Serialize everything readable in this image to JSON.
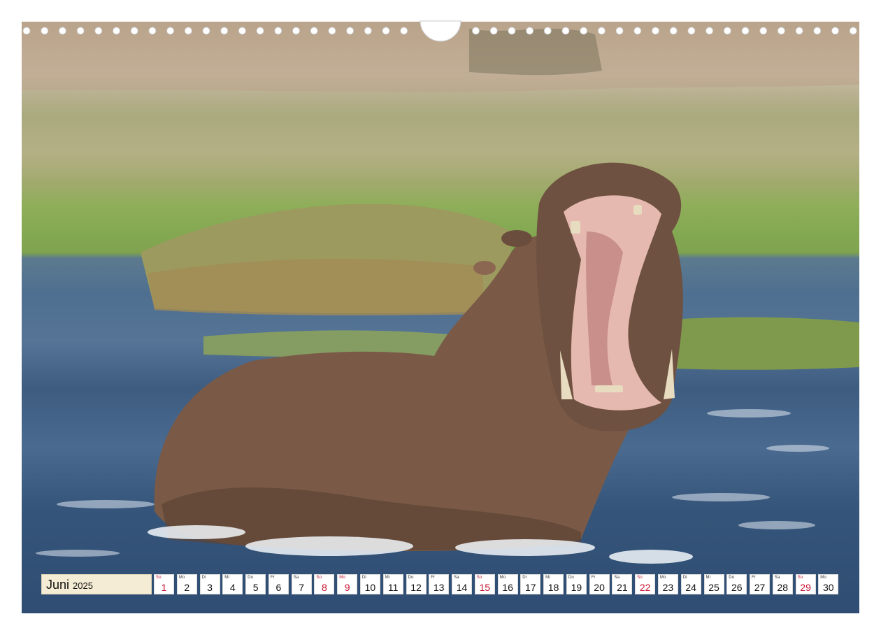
{
  "calendar": {
    "month": "Juni",
    "year": "2025",
    "accent_color": "#c8102e",
    "days": [
      {
        "n": "1",
        "wd": "So",
        "sun": true
      },
      {
        "n": "2",
        "wd": "Mo",
        "sun": false
      },
      {
        "n": "3",
        "wd": "Di",
        "sun": false
      },
      {
        "n": "4",
        "wd": "Mi",
        "sun": false
      },
      {
        "n": "5",
        "wd": "Do",
        "sun": false
      },
      {
        "n": "6",
        "wd": "Fr",
        "sun": false
      },
      {
        "n": "7",
        "wd": "Sa",
        "sun": false
      },
      {
        "n": "8",
        "wd": "So",
        "sun": true
      },
      {
        "n": "9",
        "wd": "Mo",
        "sun": true
      },
      {
        "n": "10",
        "wd": "Di",
        "sun": false
      },
      {
        "n": "11",
        "wd": "Mi",
        "sun": false
      },
      {
        "n": "12",
        "wd": "Do",
        "sun": false
      },
      {
        "n": "13",
        "wd": "Fr",
        "sun": false
      },
      {
        "n": "14",
        "wd": "Sa",
        "sun": false
      },
      {
        "n": "15",
        "wd": "So",
        "sun": true
      },
      {
        "n": "16",
        "wd": "Mo",
        "sun": false
      },
      {
        "n": "17",
        "wd": "Di",
        "sun": false
      },
      {
        "n": "18",
        "wd": "Mi",
        "sun": false
      },
      {
        "n": "19",
        "wd": "Do",
        "sun": false
      },
      {
        "n": "20",
        "wd": "Fr",
        "sun": false
      },
      {
        "n": "21",
        "wd": "Sa",
        "sun": false
      },
      {
        "n": "22",
        "wd": "So",
        "sun": true
      },
      {
        "n": "23",
        "wd": "Mo",
        "sun": false
      },
      {
        "n": "24",
        "wd": "Di",
        "sun": false
      },
      {
        "n": "25",
        "wd": "Mi",
        "sun": false
      },
      {
        "n": "26",
        "wd": "Do",
        "sun": false
      },
      {
        "n": "27",
        "wd": "Fr",
        "sun": false
      },
      {
        "n": "28",
        "wd": "Sa",
        "sun": false
      },
      {
        "n": "29",
        "wd": "So",
        "sun": true
      },
      {
        "n": "30",
        "wd": "Mo",
        "sun": false
      }
    ]
  }
}
